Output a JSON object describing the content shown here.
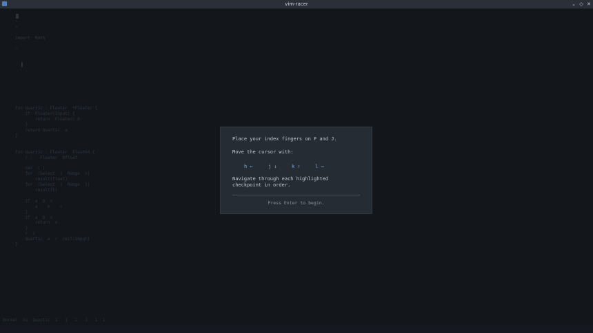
{
  "window": {
    "title": "vim-racer",
    "app_icon": "vim-racer-app-icon",
    "controls": {
      "minimize": "⌄",
      "maximize": "◇",
      "close": "✕"
    }
  },
  "editor": {
    "code": "1\n~                                                      \n~                                                      \n\nimport  Math\n\n~\n                                              \n\n  ▐                                                     \n        \n\n\n\n\n\n\nfun Quartic : Floater  *Floater {\n    if  Floater(Input) {\n        return  Floater( 0\n    }\n    return Quartic  a\n}\n\n\nfun Quartic : Floater  Float64 {\n    r :   Floater  0float\n\n    var  ( )\n    for  (Select  i  Range  n)\n        result(float)\n    for  (Select  i  Range  t)\n        result(t)\n\n    if  a  b  c\n        a    b    c\n    }\n    if  a  b  c\n        return  x\n    }\n    r  c\n    Quartic  a  r  ceil(input)\n}",
    "status": "Normal  Sq  Quartic  1   1   1   1   1  1"
  },
  "modal": {
    "line1": "Place your index fingers on F and J.",
    "line2": "Move the cursor with:",
    "keys": [
      {
        "label": "h ←",
        "icon": "arrow-left-icon"
      },
      {
        "label": "j ↓",
        "icon": "arrow-down-icon"
      },
      {
        "label": "k ↑",
        "icon": "arrow-up-icon"
      },
      {
        "label": "l →",
        "icon": "arrow-right-icon"
      }
    ],
    "line3": "Navigate through each highlighted",
    "line4": "checkpoint in order.",
    "prompt": "Press Enter to begin."
  },
  "colors": {
    "background": "#15191f",
    "titlebar": "#2b3038",
    "modal_bg": "#262c33",
    "modal_text": "#c4cad2",
    "key_accent": "#7aa8e0"
  }
}
